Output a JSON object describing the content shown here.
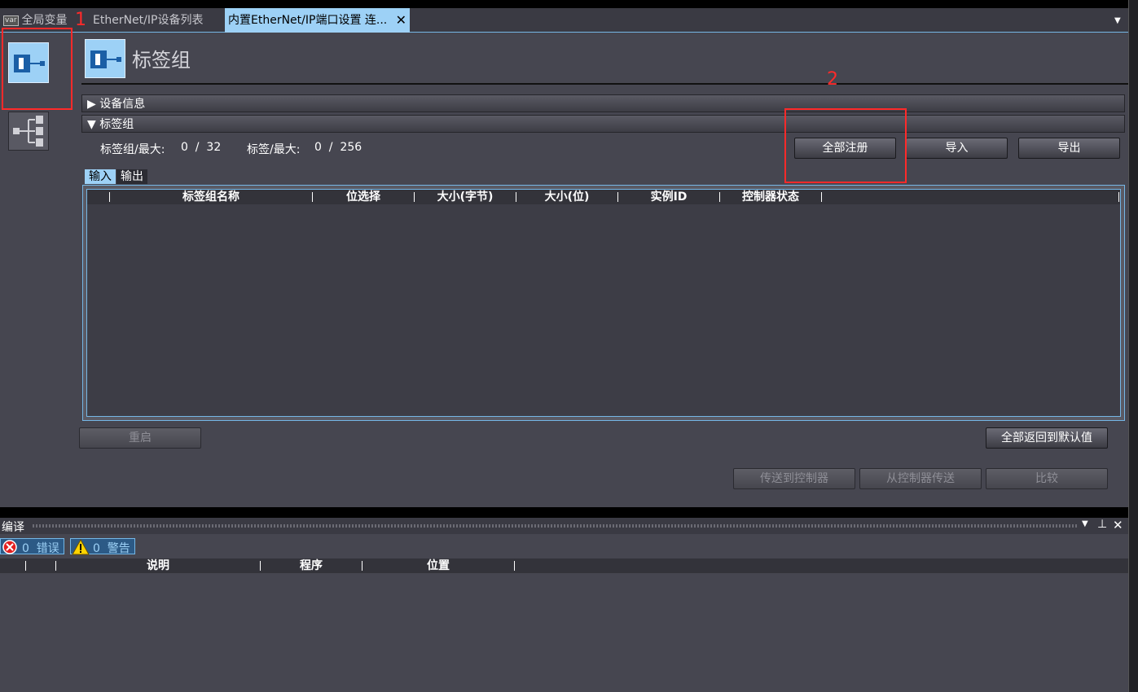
{
  "tabs": [
    {
      "label": "全局变量",
      "icon": "var"
    },
    {
      "label": "EtherNet/IP设备列表"
    },
    {
      "label": "内置EtherNet/IP端口设置 连..."
    }
  ],
  "annotations": {
    "one": "1",
    "two": "2"
  },
  "page_title": "标签组",
  "sections": {
    "device_info": "▶ 设备信息",
    "tag_group": "▼ 标签组"
  },
  "counts": {
    "tag_group_label": "标签组/最大:",
    "tag_group_value": "0  /  32",
    "tag_label": "标签/最大:",
    "tag_value": "0  /  256"
  },
  "buttons": {
    "register_all": "全部注册",
    "import": "导入",
    "export": "导出",
    "restart": "重启",
    "reset_defaults": "全部返回到默认值",
    "transfer_to": "传送到控制器",
    "transfer_from": "从控制器传送",
    "compare": "比较"
  },
  "io_tabs": {
    "input": "输入",
    "output": "输出"
  },
  "table_columns": [
    "标签组名称",
    "位选择",
    "大小(字节)",
    "大小(位)",
    "实例ID",
    "控制器状态"
  ],
  "compile": {
    "title": "编译",
    "errors": "0  错误",
    "warnings": "0  警告",
    "columns": [
      "说明",
      "程序",
      "位置"
    ]
  },
  "colors": {
    "accent": "#9dd1f6",
    "panel": "#464650",
    "annotation": "#ff2a2a"
  }
}
